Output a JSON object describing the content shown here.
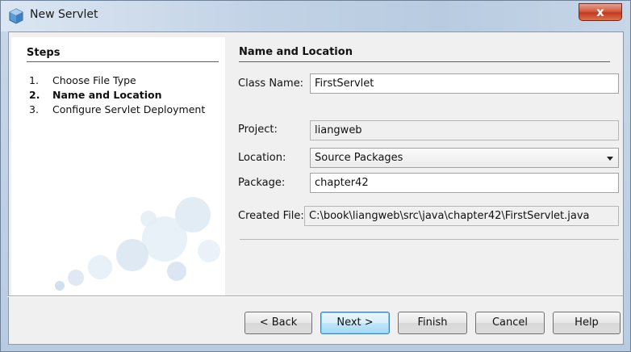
{
  "window": {
    "title": "New Servlet",
    "close_glyph": "x"
  },
  "steps": {
    "heading": "Steps",
    "items": [
      {
        "num": "1.",
        "label": "Choose File Type",
        "current": false
      },
      {
        "num": "2.",
        "label": "Name and Location",
        "current": true
      },
      {
        "num": "3.",
        "label": "Configure Servlet Deployment",
        "current": false
      }
    ]
  },
  "panel": {
    "heading": "Name and Location",
    "class_name": {
      "label": "Class Name:",
      "value": "FirstServlet"
    },
    "project": {
      "label": "Project:",
      "value": "liangweb"
    },
    "location": {
      "label": "Location:",
      "value": "Source Packages"
    },
    "package": {
      "label": "Package:",
      "value": "chapter42"
    },
    "created_file": {
      "label": "Created File:",
      "value": "C:\\book\\liangweb\\src\\java\\chapter42\\FirstServlet.java"
    }
  },
  "buttons": {
    "back": "< Back",
    "next": "Next >",
    "finish": "Finish",
    "cancel": "Cancel",
    "help": "Help"
  },
  "colors": {
    "accent": "#3c7fb1",
    "close": "#c2391e"
  },
  "icons": {
    "title": "netbeans-cube-icon",
    "close": "close-icon",
    "dropdown": "chevron-down-icon"
  }
}
